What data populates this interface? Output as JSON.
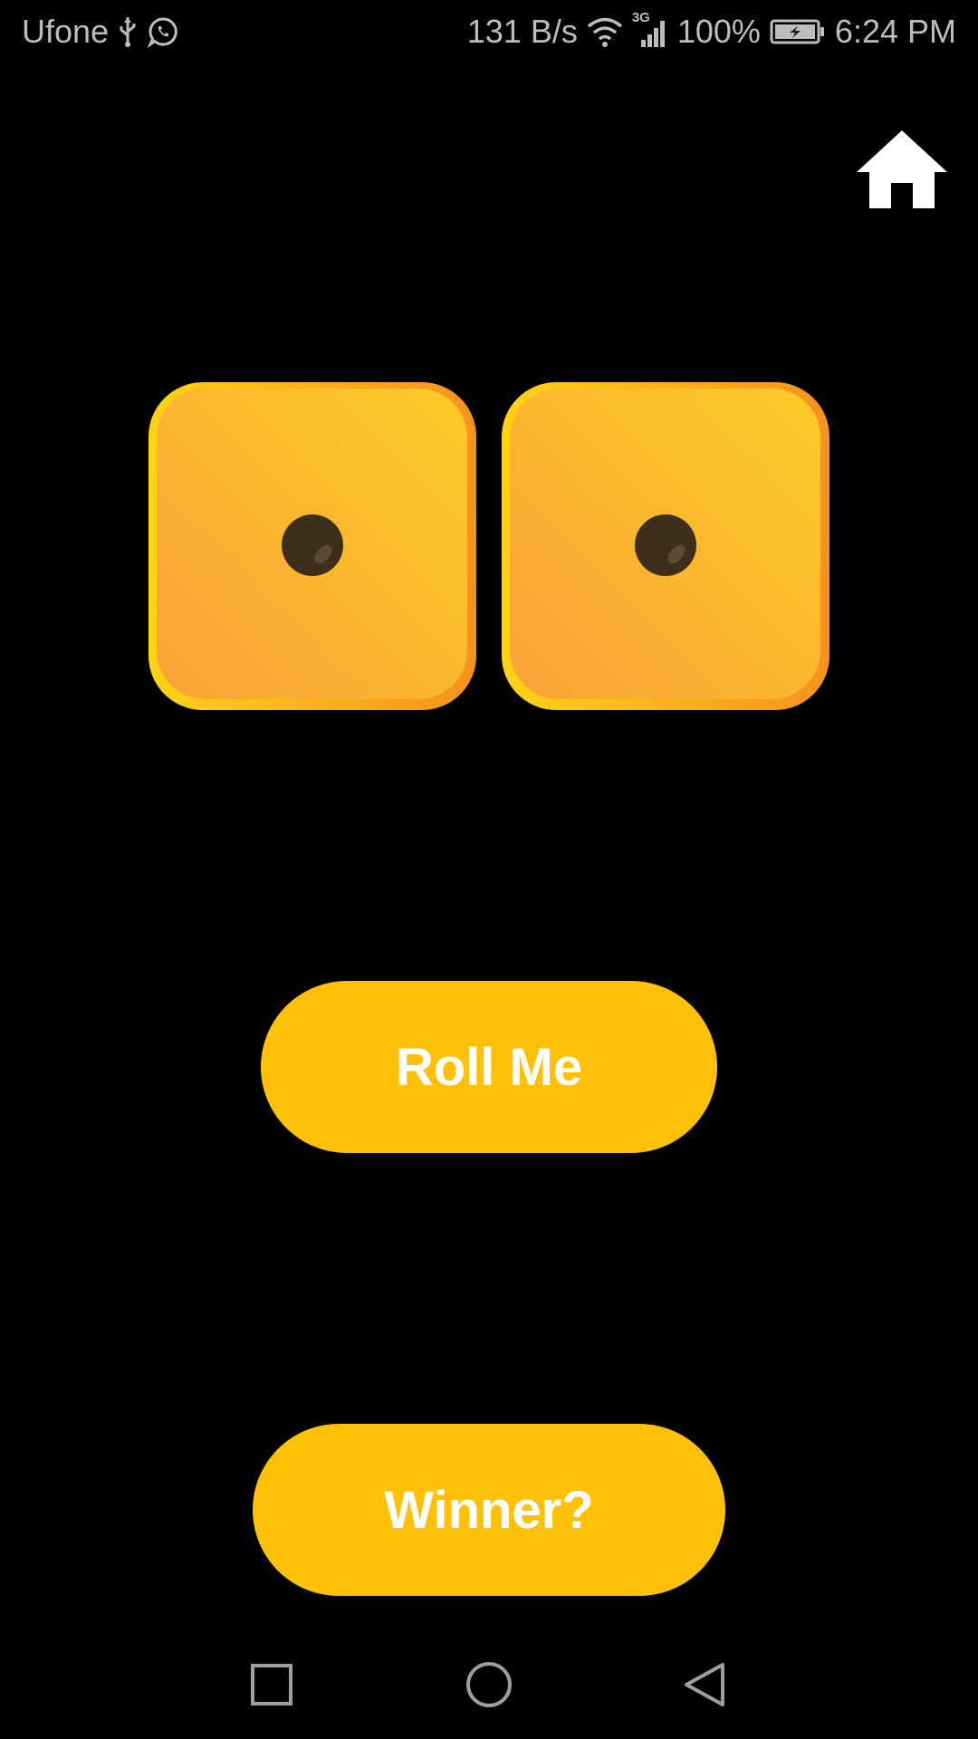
{
  "status_bar": {
    "carrier": "Ufone",
    "net_speed": "131 B/s",
    "network_type": "3G",
    "battery": "100%",
    "time": "6:24 PM",
    "icons": [
      "usb-icon",
      "whatsapp-icon",
      "wifi-icon",
      "signal-icon",
      "battery-charging-icon"
    ]
  },
  "toolbar": {
    "home_icon": "home-icon"
  },
  "dice": {
    "left_value": 1,
    "right_value": 1
  },
  "buttons": {
    "roll_label": "Roll Me",
    "winner_label": "Winner?"
  },
  "nav_bar": {
    "icons": [
      "recent-apps-icon",
      "home-circle-icon",
      "back-icon"
    ]
  },
  "colors": {
    "background": "#000000",
    "accent": "#FFC107",
    "die_face": "#FBB82E",
    "pip": "#3E2F1C",
    "status_text": "#BDBDBD"
  }
}
